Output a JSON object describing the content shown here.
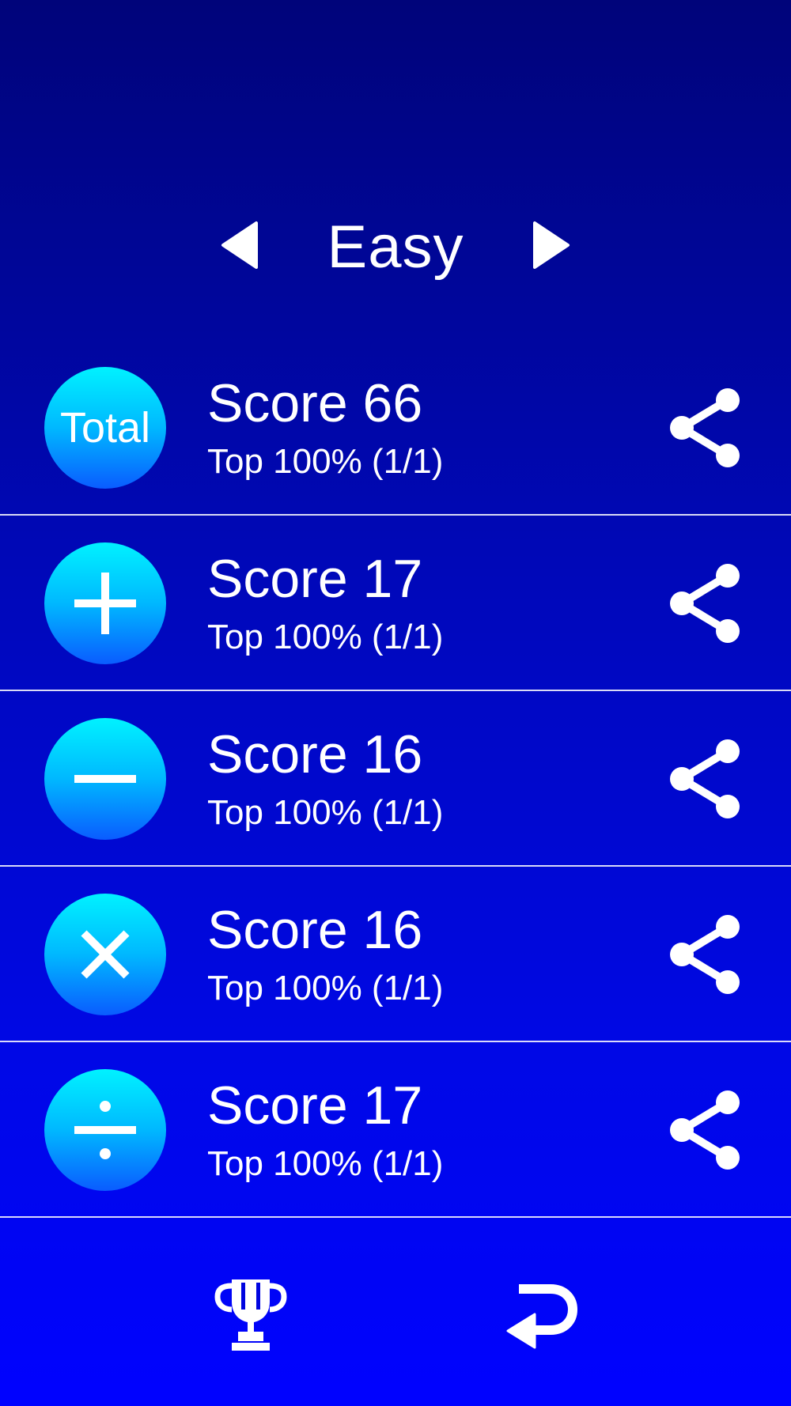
{
  "difficulty": {
    "label": "Easy",
    "prev_icon": "triangle-left-icon",
    "next_icon": "triangle-right-icon"
  },
  "rows": [
    {
      "category": "total",
      "icon_text": "Total",
      "score": "Score 66",
      "rank": "Top 100% (1/1)",
      "share_icon": "share-icon"
    },
    {
      "category": "addition",
      "icon": "plus-icon",
      "score": "Score 17",
      "rank": "Top 100% (1/1)",
      "share_icon": "share-icon"
    },
    {
      "category": "subtraction",
      "icon": "minus-icon",
      "score": "Score 16",
      "rank": "Top 100% (1/1)",
      "share_icon": "share-icon"
    },
    {
      "category": "multiplication",
      "icon": "multiply-icon",
      "score": "Score 16",
      "rank": "Top 100% (1/1)",
      "share_icon": "share-icon"
    },
    {
      "category": "division",
      "icon": "divide-icon",
      "score": "Score 17",
      "rank": "Top 100% (1/1)",
      "share_icon": "share-icon"
    }
  ],
  "toolbar": {
    "leaderboard_icon": "trophy-icon",
    "back_icon": "return-arrow-icon"
  },
  "colors": {
    "background_top": "#00047A",
    "background_bottom": "#0002FF",
    "icon_gradient_top": "#00F2FF",
    "icon_gradient_bottom": "#0A5CFF",
    "text": "#FFFFFF"
  }
}
